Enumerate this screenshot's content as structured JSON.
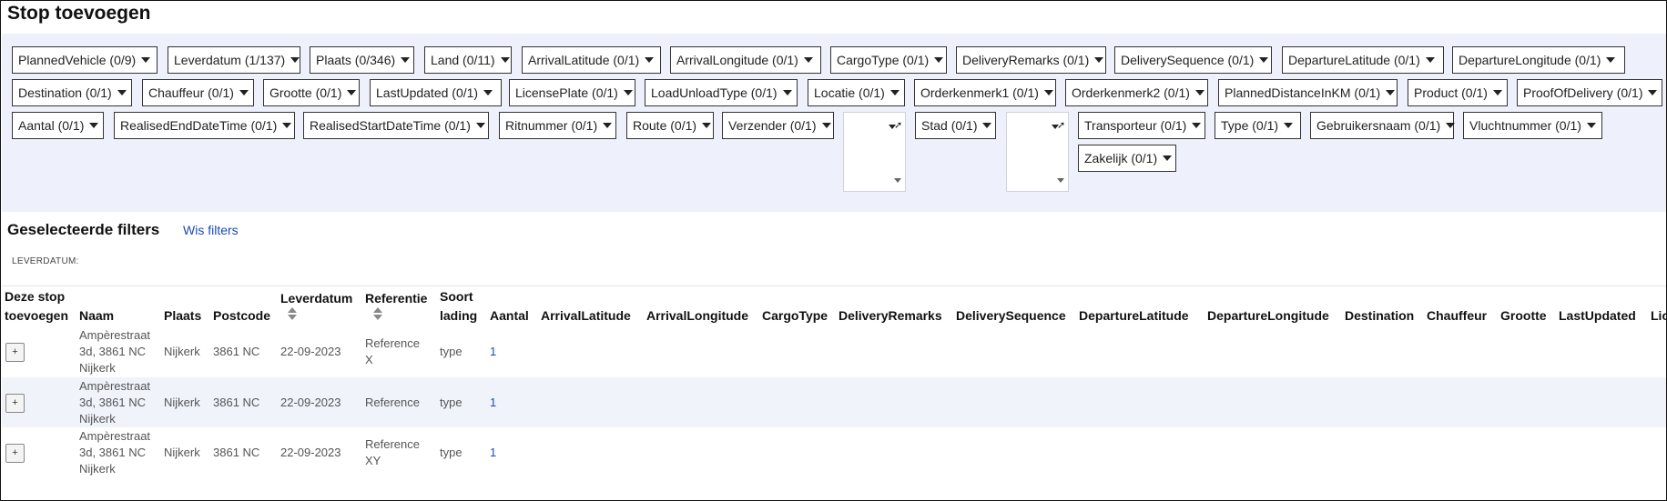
{
  "page": {
    "title": "Stop toevoegen"
  },
  "filters": {
    "row1": [
      "PlannedVehicle (0/9)",
      "Leverdatum (1/137)",
      "Plaats (0/346)",
      "Land (0/11)",
      "ArrivalLatitude (0/1)",
      "ArrivalLongitude (0/1)",
      "CargoType (0/1)",
      "DeliveryRemarks (0/1)",
      "DeliverySequence (0/1)",
      "DepartureLatitude (0/1)",
      "DepartureLongitude (0/1)"
    ],
    "row2": [
      "Destination (0/1)",
      "Chauffeur (0/1)",
      "Grootte (0/1)",
      "LastUpdated (0/1)",
      "LicensePlate (0/1)",
      "LoadUnloadType (0/1)",
      "Locatie (0/1)",
      "Orderkenmerk1 (0/1)",
      "Orderkenmerk2 (0/1)",
      "PlannedDistanceInKM (0/1)",
      "Product (0/1)",
      "ProofOfDelivery (0/1)"
    ],
    "row3": [
      "Aantal (0/1)",
      "RealisedEndDateTime (0/1)",
      "RealisedStartDateTime (0/1)",
      "Ritnummer (0/1)",
      "Route (0/1)",
      "Verzender (0/1)",
      "Stad (0/1)",
      "Transporteur (0/1)",
      "Type (0/1)",
      "Gebruikersnaam (0/1)",
      "Vluchtnummer (0/1)"
    ],
    "row4": [
      "Zakelijk (0/1)"
    ]
  },
  "selected": {
    "title": "Geselecteerde filters",
    "clear_label": "Wis filters",
    "leverdatum_label": "LEVERDATUM:"
  },
  "table": {
    "headers": {
      "add": [
        "Deze stop",
        "toevoegen"
      ],
      "naam": "Naam",
      "plaats": "Plaats",
      "postcode": "Postcode",
      "leverdatum": "Leverdatum",
      "referentie": "Referentie",
      "soort": [
        "Soort",
        "lading"
      ],
      "aantal": "Aantal",
      "arrival_lat": "ArrivalLatitude",
      "arrival_lon": "ArrivalLongitude",
      "cargotype": "CargoType",
      "delivery_remarks": "DeliveryRemarks",
      "delivery_sequence": "DeliverySequence",
      "departure_lat": "DepartureLatitude",
      "departure_lon": "DepartureLongitude",
      "destination": "Destination",
      "chauffeur": "Chauffeur",
      "grootte": "Grootte",
      "lastupdated": "LastUpdated",
      "license": "Lic"
    },
    "rows": [
      {
        "add": "+",
        "naam": [
          "Ampèrestraat",
          "3d, 3861 NC",
          "Nijkerk"
        ],
        "plaats": "Nijkerk",
        "postcode": "3861 NC",
        "leverdatum": "22-09-2023",
        "referentie": [
          "Reference",
          "X"
        ],
        "soort": "type",
        "aantal": "1"
      },
      {
        "add": "+",
        "naam": [
          "Ampèrestraat",
          "3d, 3861 NC",
          "Nijkerk"
        ],
        "plaats": "Nijkerk",
        "postcode": "3861 NC",
        "leverdatum": "22-09-2023",
        "referentie": [
          "Reference"
        ],
        "soort": "type",
        "aantal": "1"
      },
      {
        "add": "+",
        "naam": [
          "Ampèrestraat",
          "3d, 3861 NC",
          "Nijkerk"
        ],
        "plaats": "Nijkerk",
        "postcode": "3861 NC",
        "leverdatum": "22-09-2023",
        "referentie": [
          "Reference",
          "XY"
        ],
        "soort": "type",
        "aantal": "1"
      }
    ]
  },
  "icons": {
    "caret": "chevron-down-icon",
    "sort": "sort-icon",
    "resize": "resize-arrow-icon"
  }
}
